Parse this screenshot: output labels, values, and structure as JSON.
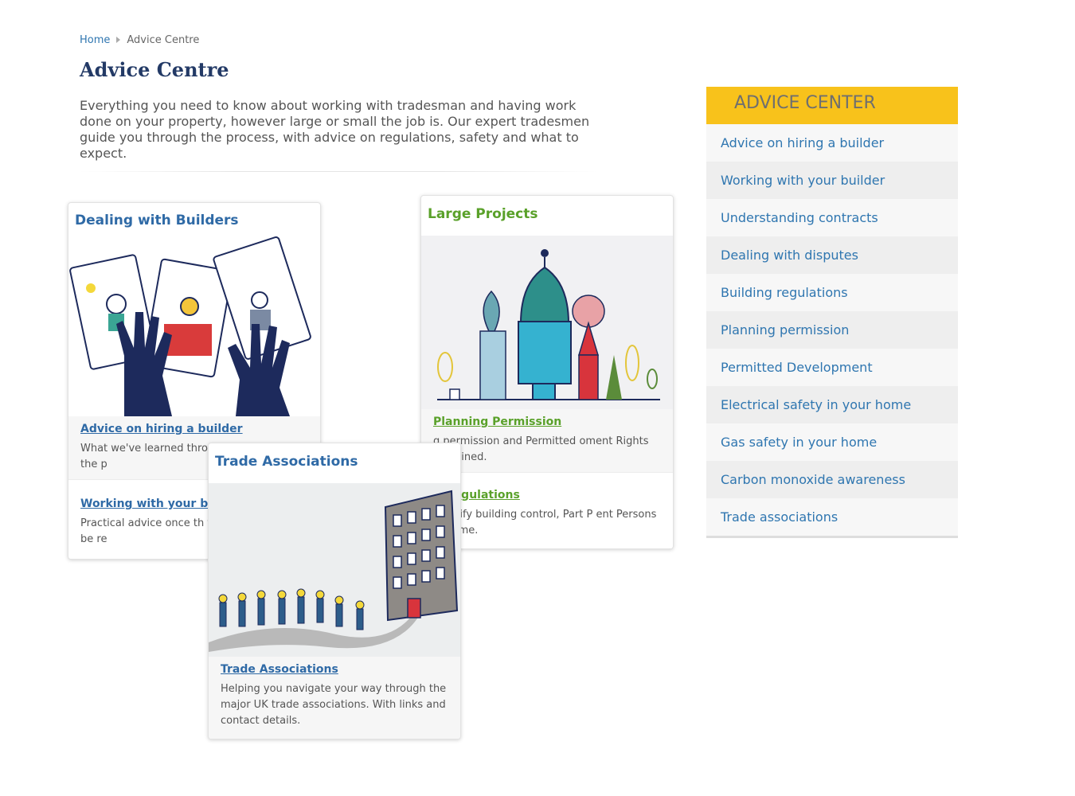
{
  "breadcrumb": {
    "home": "Home",
    "current": "Advice Centre"
  },
  "page": {
    "title": "Advice Centre",
    "intro": "Everything you need to know about working with tradesman and having work done on your property, however large or small the job is. Our expert tradesmen guide you through the process, with advice on regulations, safety and what to expect."
  },
  "cards": {
    "builders": {
      "title": "Dealing with Builders",
      "links": [
        {
          "label": "Advice on hiring a builder",
          "desc": "What we've learned thro experience. Avoid the p"
        },
        {
          "label": "Working with your bu",
          "desc": "Practical advice once th to expect, how to be re"
        }
      ]
    },
    "large": {
      "title": "Large Projects",
      "links": [
        {
          "label": "Planning Permission",
          "desc": "g permission and Permitted oment Rights explained."
        },
        {
          "label": "g Regulations",
          "desc": "o notify building control, Part P ent Persons Scheme."
        }
      ]
    },
    "trade": {
      "title": "Trade Associations",
      "links": [
        {
          "label": "Trade Associations",
          "desc": "Helping you navigate your way through the major UK trade associations. With links and contact details."
        }
      ]
    }
  },
  "sidebar": {
    "heading": "ADVICE CENTER",
    "items": [
      {
        "label": "Advice on hiring a builder"
      },
      {
        "label": "Working with your builder"
      },
      {
        "label": "Understanding contracts"
      },
      {
        "label": "Dealing with disputes"
      },
      {
        "label": "Building regulations"
      },
      {
        "label": "Planning permission"
      },
      {
        "label": "Permitted Development"
      },
      {
        "label": "Electrical safety in your home"
      },
      {
        "label": "Gas safety in your home"
      },
      {
        "label": "Carbon monoxide awareness"
      },
      {
        "label": "Trade associations"
      }
    ]
  },
  "colors": {
    "link_blue": "#2f76b0",
    "title_navy": "#233a66",
    "green": "#5aa12a",
    "sidebar_yellow": "#f8c21b"
  }
}
